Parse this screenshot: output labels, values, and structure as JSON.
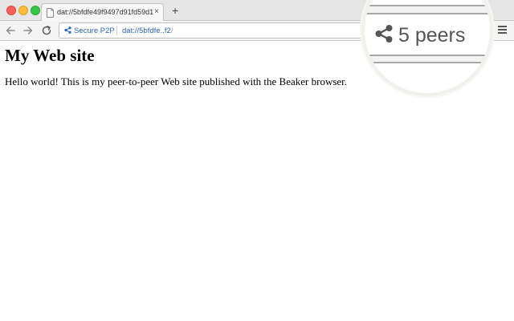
{
  "window": {
    "tab_title": "dat://5bfdfe49f9497d91fd59d1...",
    "tab_close": "×",
    "new_tab": "+"
  },
  "toolbar": {
    "secure_label": "Secure P2P",
    "url_prefix": "dat://",
    "url_host": "5bfdfe..f2",
    "url_suffix": "/"
  },
  "page": {
    "title": "My Web site",
    "body": "Hello world! This is my peer-to-peer Web site published with the Beaker browser."
  },
  "callout": {
    "peers_label": "5 peers",
    "icon": "share-icon"
  },
  "colors": {
    "link": "#2d63c4",
    "peers_text": "#555555",
    "close_dot": "#fc605c",
    "min_dot": "#fdbc40",
    "max_dot": "#34c84a"
  }
}
